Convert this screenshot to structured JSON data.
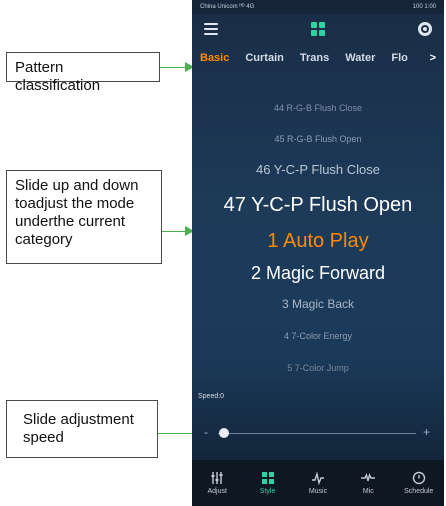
{
  "status_bar": {
    "carrier": "China Unicom ᴴᴰ 4G",
    "right": "100 1:00"
  },
  "tabs": [
    "Basic",
    "Curtain",
    "Trans",
    "Water",
    "Flo"
  ],
  "tabs_more": ">",
  "modes": [
    "44 R-G-B Flush Close",
    "45 R-G-B Flush Open",
    "46 Y-C-P Flush Close",
    "47 Y-C-P Flush Open",
    "1 Auto Play",
    "2 Magic Forward",
    "3 Magic Back",
    "4 7-Color Energy",
    "5 7-Color Jump"
  ],
  "selected_index": 4,
  "speed": {
    "label": "Speed:0",
    "minus": "-",
    "plus": "+",
    "value_fraction": 0.03
  },
  "bottom_nav": [
    {
      "label": "Adjust",
      "icon": "sliders-icon"
    },
    {
      "label": "Style",
      "icon": "grid-icon"
    },
    {
      "label": "Music",
      "icon": "music-icon"
    },
    {
      "label": "Mic",
      "icon": "mic-icon"
    },
    {
      "label": "Schedule",
      "icon": "clock-icon"
    }
  ],
  "callouts": {
    "pattern": "Pattern classification",
    "slide_mode": "Slide up and down toadjust the mode underthe current category",
    "speed": "Slide adjustment speed"
  },
  "colors": {
    "accent_orange": "#ff8a00",
    "accent_green": "#2ed3a2",
    "arrow_green": "#4caf50"
  }
}
